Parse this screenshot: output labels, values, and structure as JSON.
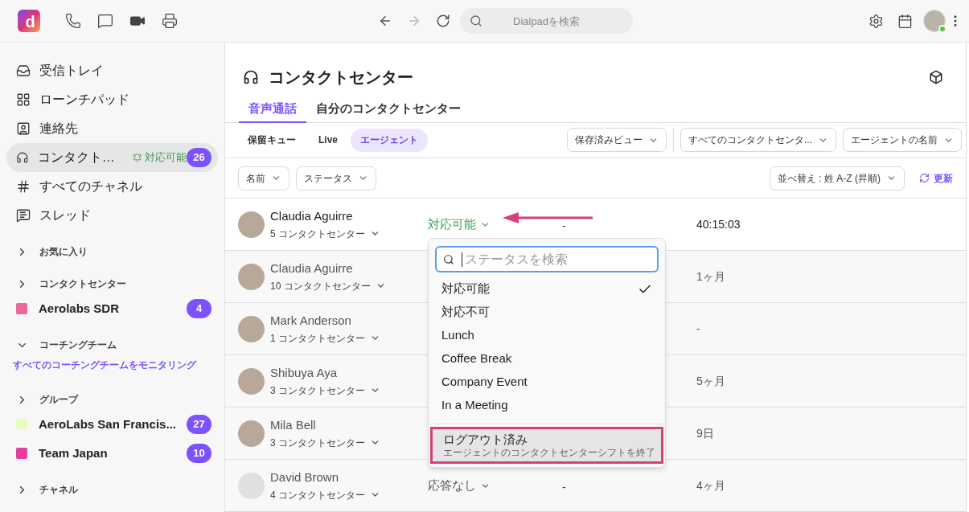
{
  "topbar": {
    "search": {
      "placeholder": "Dialpadを検索"
    },
    "logo_letter": "d",
    "user_online": true
  },
  "sidebar": [
    {
      "kind": "nav",
      "label": "受信トレイ",
      "selected": false
    },
    {
      "kind": "nav",
      "label": "ローンチパッド",
      "selected": false
    },
    {
      "kind": "nav",
      "label": "連絡先",
      "selected": false
    },
    {
      "kind": "nav",
      "label": "コンタクト…",
      "selected": true,
      "status": "対応可能",
      "badge": "26"
    },
    {
      "kind": "nav",
      "label": "すべてのチャネル",
      "selected": false
    },
    {
      "kind": "nav",
      "label": "スレッド",
      "selected": false
    },
    {
      "kind": "section",
      "label": "お気に入り",
      "expanded": false
    },
    {
      "kind": "section",
      "label": "コンタクトセンター",
      "expanded": false
    },
    {
      "kind": "channel",
      "label": "Aerolabs SDR",
      "color": "#e8699a",
      "badge": "4"
    },
    {
      "kind": "section",
      "label": "コーチングチーム",
      "expanded": true
    },
    {
      "kind": "link",
      "label": "すべてのコーチングチームをモニタリング"
    },
    {
      "kind": "section",
      "label": "グループ",
      "expanded": false
    },
    {
      "kind": "channel",
      "label": "AeroLabs San Francis...",
      "color": "#e6fcc0",
      "badge": "27"
    },
    {
      "kind": "channel",
      "label": "Team Japan",
      "color": "#e83e9c",
      "badge": "10"
    },
    {
      "kind": "section",
      "label": "チャネル",
      "expanded": false
    }
  ],
  "page": {
    "title": "コンタクトセンター",
    "tabs": [
      {
        "label": "音声通話",
        "selected": true
      },
      {
        "label": "自分のコンタクトセンター",
        "selected": false
      }
    ],
    "subtabs": [
      {
        "label": "保留キュー",
        "selected": false
      },
      {
        "label": "Live",
        "selected": false
      },
      {
        "label": "エージェント",
        "selected": true
      }
    ],
    "view_filters": [
      "保存済みビュー",
      "すべてのコンタクトセンタ...",
      "エージェントの名前"
    ],
    "filters": [
      "名前",
      "ステータス"
    ],
    "sort": "並べ替え : 姓 A-Z (昇順)",
    "refresh": "更新"
  },
  "rows": [
    {
      "name": "Claudia Aguirre",
      "centers": "5 コンタクトセンター",
      "status": "対応可能",
      "available": true,
      "column_3": "-",
      "column_4": "40:15:03",
      "active": true
    },
    {
      "name": "Claudia Aguirre",
      "centers": "10 コンタクトセンター",
      "column_4": "1ヶ月",
      "active": false
    },
    {
      "name": "Mark Anderson",
      "centers": "1 コンタクトセンター",
      "column_4": "-",
      "active": false
    },
    {
      "name": "Shibuya Aya",
      "centers": "3 コンタクトセンター",
      "column_4": "5ヶ月",
      "active": false
    },
    {
      "name": "Mila Bell",
      "centers": "3 コンタクトセンター",
      "column_4": "9日",
      "active": false
    },
    {
      "name": "David Brown",
      "centers": "4 コンタクトセンター",
      "status": "応答なし",
      "available": false,
      "column_3": "-",
      "column_4": "4ヶ月",
      "active": false
    }
  ],
  "status_menu": {
    "search": {
      "placeholder": "ステータスを検索"
    },
    "options": [
      {
        "label": "対応可能",
        "selected": true,
        "highlighted": false
      },
      {
        "label": "対応不可",
        "selected": false,
        "highlighted": false
      },
      {
        "label": "Lunch",
        "selected": false,
        "highlighted": false
      },
      {
        "label": "Coffee Break",
        "selected": false,
        "highlighted": false
      },
      {
        "label": "Company Event",
        "selected": false,
        "highlighted": false
      },
      {
        "label": "In a Meeting",
        "selected": false,
        "highlighted": false
      }
    ],
    "logout": {
      "label": "ログアウト済み",
      "description": "エージェントのコンタクトセンターシフトを終了",
      "highlighted": true
    }
  }
}
